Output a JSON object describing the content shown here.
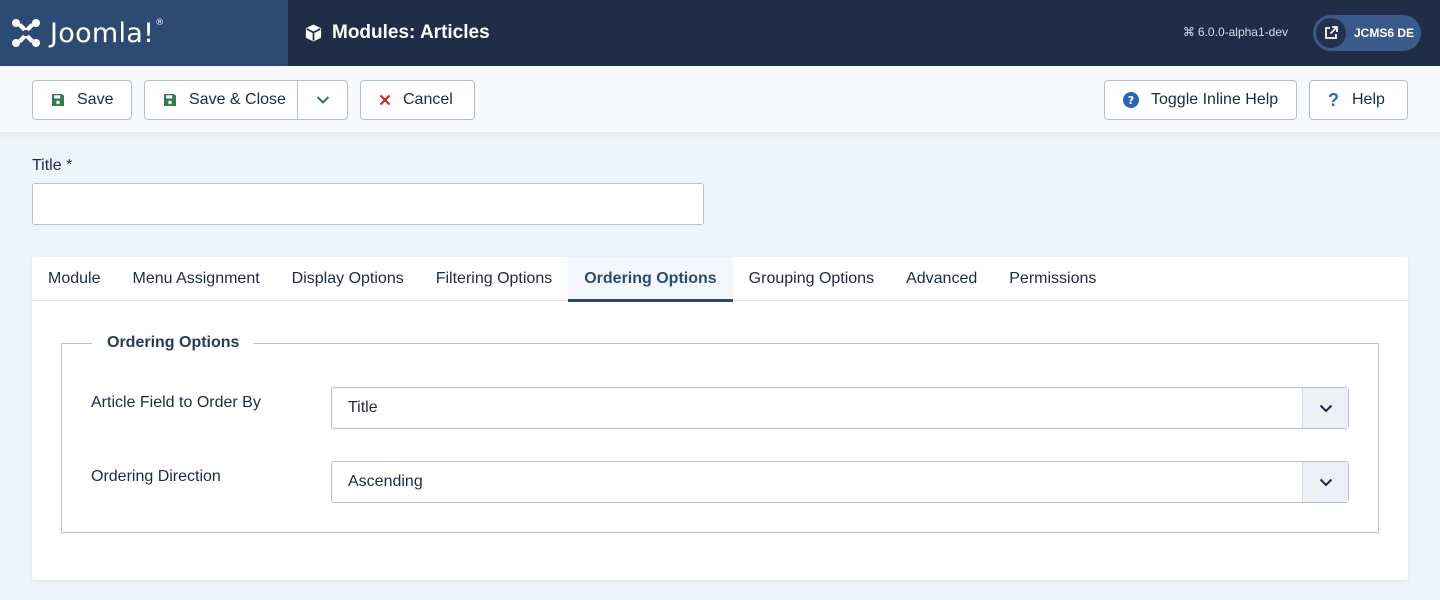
{
  "brand": {
    "name": "Joomla!",
    "registered": "®"
  },
  "header": {
    "title": "Modules: Articles",
    "version": "6.0.0-alpha1-dev",
    "site_label": "JCMS6 DE"
  },
  "toolbar": {
    "save_label": "Save",
    "save_close_label": "Save & Close",
    "cancel_label": "Cancel",
    "toggle_help_label": "Toggle Inline Help",
    "help_label": "Help"
  },
  "title_field": {
    "label": "Title *",
    "value": "",
    "placeholder": ""
  },
  "tabs": [
    {
      "label": "Module"
    },
    {
      "label": "Menu Assignment"
    },
    {
      "label": "Display Options"
    },
    {
      "label": "Filtering Options"
    },
    {
      "label": "Ordering Options",
      "active": true
    },
    {
      "label": "Grouping Options"
    },
    {
      "label": "Advanced"
    },
    {
      "label": "Permissions"
    }
  ],
  "ordering": {
    "legend": "Ordering Options",
    "order_by": {
      "label": "Article Field to Order By",
      "value": "Title"
    },
    "direction": {
      "label": "Ordering Direction",
      "value": "Ascending"
    }
  },
  "colors": {
    "header_bg": "#1f2d47",
    "brand_bg": "#2d4a73",
    "accent": "#2d4a73",
    "save_icon": "#2e7d4f",
    "cancel_icon": "#c52827",
    "help_icon": "#2a67b0"
  },
  "icons": {
    "brand": "joomla-logo-icon",
    "module": "cube-icon",
    "version": "joomla-small-icon",
    "external": "external-link-icon",
    "save": "floppy-disk-icon",
    "dropdown": "chevron-down-icon",
    "cancel": "close-icon",
    "toggle_help": "question-circle-icon",
    "help": "question-icon"
  }
}
